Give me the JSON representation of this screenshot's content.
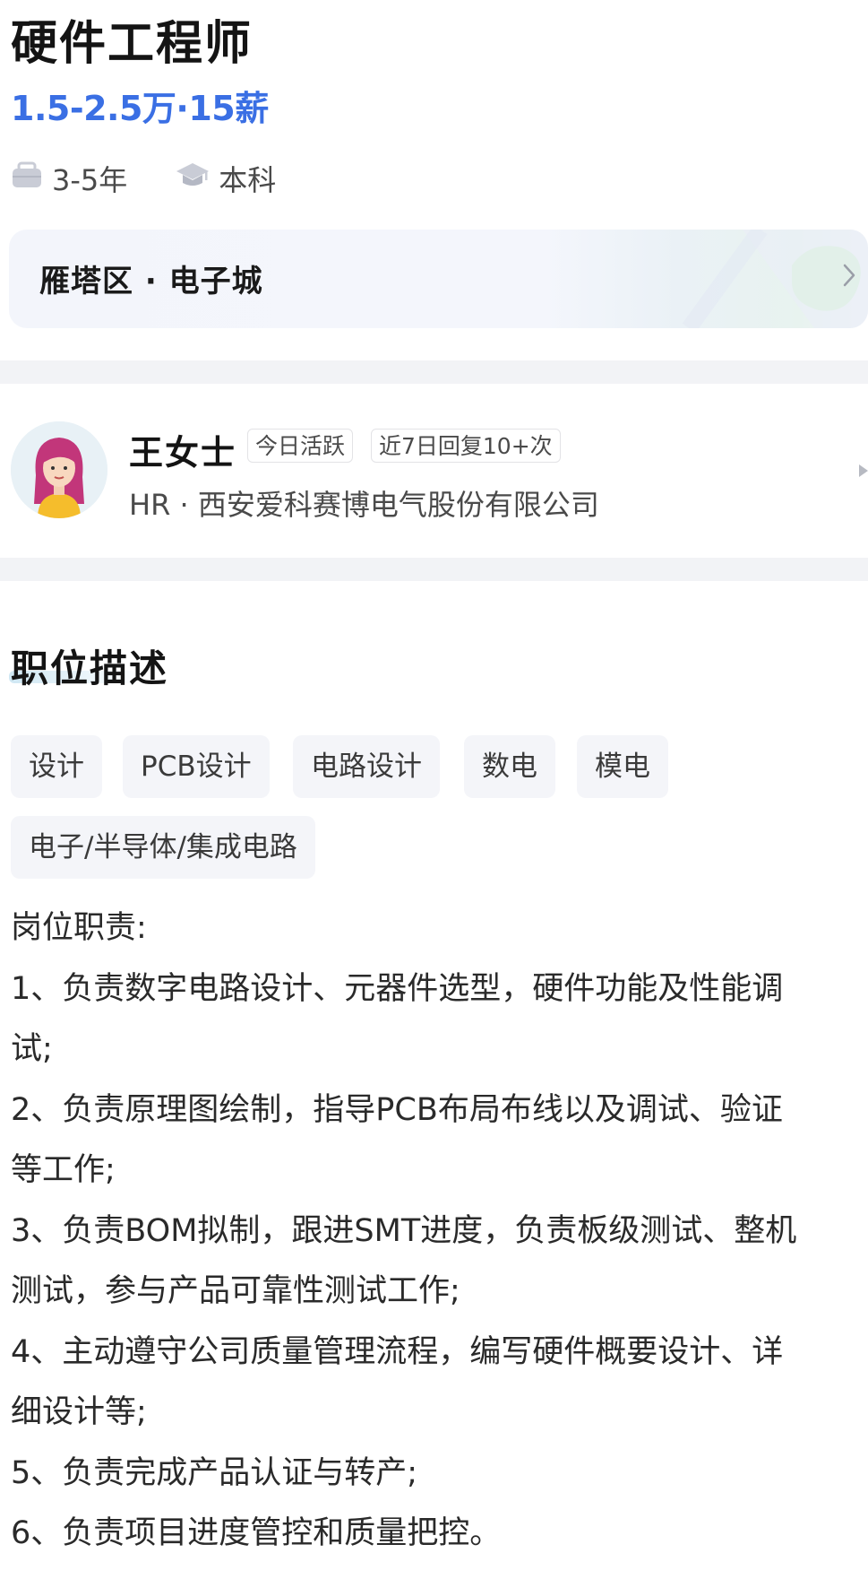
{
  "job": {
    "title": "硬件工程师",
    "salary": "1.5-2.5万·15薪",
    "experience": "3-5年",
    "education": "本科"
  },
  "location": {
    "text": "雁塔区 · 电子城"
  },
  "recruiter": {
    "name": "王女士",
    "badges": [
      "今日活跃",
      "近7日回复10+次"
    ],
    "company_line": "HR · 西安爱科赛博电气股份有限公司"
  },
  "description": {
    "section_title": "职位描述",
    "tags": [
      "设计",
      "PCB设计",
      "电路设计",
      "数电",
      "模电",
      "电子/半导体/集成电路"
    ],
    "lines": [
      "岗位职责:",
      "1、负责数字电路设计、元器件选型，硬件功能及性能调",
      "试;",
      "2、负责原理图绘制，指导PCB布局布线以及调试、验证",
      "等工作;",
      "3、负责BOM拟制，跟进SMT进度，负责板级测试、整机",
      "测试，参与产品可靠性测试工作;",
      "4、主动遵守公司质量管理流程，编写硬件概要设计、详",
      "细设计等;",
      "5、负责完成产品认证与转产;",
      "6、负责项目进度管控和质量把控。"
    ]
  },
  "icons": {
    "experience": "briefcase-icon",
    "education": "graduation-cap-icon",
    "location_arrow": "chevron-right-icon",
    "recruiter_arrow": "triangle-right-icon"
  },
  "colors": {
    "salary": "#3a6fe4",
    "divider": "#f2f3f6",
    "tag_bg": "#f4f5f9"
  }
}
